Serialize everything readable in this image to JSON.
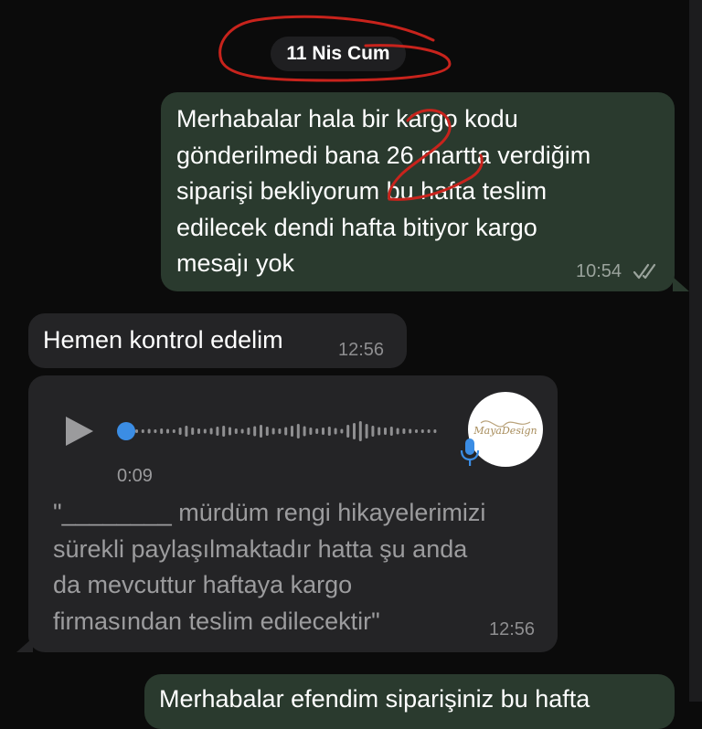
{
  "date_label": "11 Nis Cum",
  "messages": [
    {
      "direction": "outgoing",
      "text": "Merhabalar hala bir kargo kodu gönderilmedi bana 26 martta verdiğim siparişi bekliyorum bu hafta teslim edilecek dendi hafta bitiyor kargo mesajı yok",
      "lines": [
        "Merhabalar hala bir kargo kodu",
        "gönderilmedi bana 26 martta verdiğim",
        "siparişi bekliyorum bu hafta teslim",
        "edilecek dendi hafta bitiyor kargo",
        "mesajı yok"
      ],
      "time": "10:54",
      "status": "read"
    },
    {
      "direction": "incoming",
      "text": "Hemen kontrol edelim",
      "time": "12:56"
    },
    {
      "direction": "incoming",
      "type": "voice",
      "duration": "0:09",
      "progress": 0,
      "avatar_text": "MayaDesign",
      "transcript_lines": [
        "\"________ mürdüm rengi hikayelerimizi",
        "sürekli paylaşılmaktadır hatta şu anda",
        "da mevcuttur haftaya kargo",
        "firmasından teslim edilecektir\""
      ],
      "time": "12:56"
    },
    {
      "direction": "outgoing",
      "partial_text": "Merhabalar efendim siparişiniz bu hafta"
    }
  ],
  "icons": {
    "play": "play-icon",
    "mic": "microphone-icon",
    "ticks": "double-check-icon"
  },
  "colors": {
    "outgoing_bubble": "#2a3a2e",
    "incoming_bubble": "#242426",
    "annotation_red": "#c8231c",
    "voice_accent": "#3b8de4"
  }
}
